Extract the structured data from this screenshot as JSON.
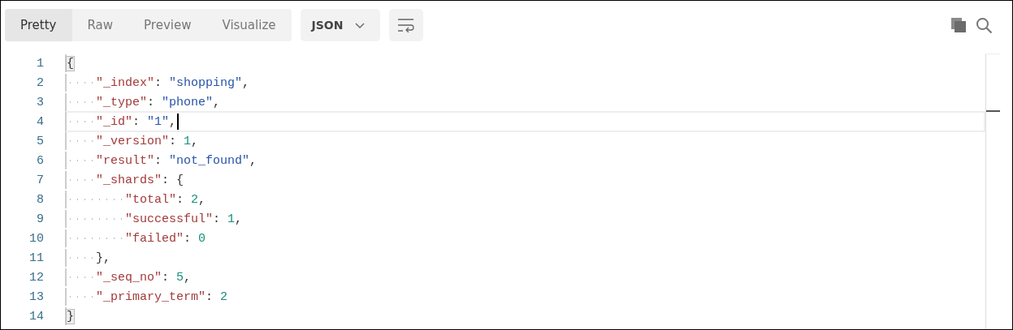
{
  "tabs": [
    {
      "label": "Pretty",
      "selected": true
    },
    {
      "label": "Raw",
      "selected": false
    },
    {
      "label": "Preview",
      "selected": false
    },
    {
      "label": "Visualize",
      "selected": false
    }
  ],
  "format_dropdown": {
    "value": "JSON"
  },
  "editor": {
    "lines": [
      {
        "number": "1",
        "current": false,
        "tokens": [
          {
            "kind": "brace_match",
            "text": "{"
          }
        ],
        "children": [
          {
            "number": "2",
            "current": false,
            "tokens": [
              {
                "kind": "key",
                "text": "\"_index\""
              },
              {
                "kind": "punct",
                "text": ": "
              },
              {
                "kind": "string",
                "text": "\"shopping\""
              },
              {
                "kind": "punct",
                "text": ","
              }
            ]
          },
          {
            "number": "3",
            "current": false,
            "tokens": [
              {
                "kind": "key",
                "text": "\"_type\""
              },
              {
                "kind": "punct",
                "text": ": "
              },
              {
                "kind": "string",
                "text": "\"phone\""
              },
              {
                "kind": "punct",
                "text": ","
              }
            ]
          },
          {
            "number": "4",
            "current": true,
            "tokens": [
              {
                "kind": "key",
                "text": "\"_id\""
              },
              {
                "kind": "punct",
                "text": ": "
              },
              {
                "kind": "string",
                "text": "\"1\""
              },
              {
                "kind": "punct",
                "text": ","
              }
            ]
          },
          {
            "number": "5",
            "current": false,
            "tokens": [
              {
                "kind": "key",
                "text": "\"_version\""
              },
              {
                "kind": "punct",
                "text": ": "
              },
              {
                "kind": "number",
                "text": "1"
              },
              {
                "kind": "punct",
                "text": ","
              }
            ]
          },
          {
            "number": "6",
            "current": false,
            "tokens": [
              {
                "kind": "key",
                "text": "\"result\""
              },
              {
                "kind": "punct",
                "text": ": "
              },
              {
                "kind": "string",
                "text": "\"not_found\""
              },
              {
                "kind": "punct",
                "text": ","
              }
            ]
          },
          {
            "number": "7",
            "current": false,
            "tokens": [
              {
                "kind": "key",
                "text": "\"_shards\""
              },
              {
                "kind": "punct",
                "text": ": {"
              }
            ],
            "children": [
              {
                "number": "8",
                "current": false,
                "tokens": [
                  {
                    "kind": "key",
                    "text": "\"total\""
                  },
                  {
                    "kind": "punct",
                    "text": ": "
                  },
                  {
                    "kind": "number",
                    "text": "2"
                  },
                  {
                    "kind": "punct",
                    "text": ","
                  }
                ]
              },
              {
                "number": "9",
                "current": false,
                "tokens": [
                  {
                    "kind": "key",
                    "text": "\"successful\""
                  },
                  {
                    "kind": "punct",
                    "text": ": "
                  },
                  {
                    "kind": "number",
                    "text": "1"
                  },
                  {
                    "kind": "punct",
                    "text": ","
                  }
                ]
              },
              {
                "number": "10",
                "current": false,
                "tokens": [
                  {
                    "kind": "key",
                    "text": "\"failed\""
                  },
                  {
                    "kind": "punct",
                    "text": ": "
                  },
                  {
                    "kind": "number",
                    "text": "0"
                  }
                ]
              }
            ]
          },
          {
            "number": "11",
            "current": false,
            "tokens": [
              {
                "kind": "punct",
                "text": "},"
              }
            ]
          },
          {
            "number": "12",
            "current": false,
            "tokens": [
              {
                "kind": "key",
                "text": "\"_seq_no\""
              },
              {
                "kind": "punct",
                "text": ": "
              },
              {
                "kind": "number",
                "text": "5"
              },
              {
                "kind": "punct",
                "text": ","
              }
            ]
          },
          {
            "number": "13",
            "current": false,
            "tokens": [
              {
                "kind": "key",
                "text": "\"_primary_term\""
              },
              {
                "kind": "punct",
                "text": ": "
              },
              {
                "kind": "number",
                "text": "2"
              }
            ]
          }
        ]
      },
      {
        "number": "14",
        "current": false,
        "tokens": [
          {
            "kind": "brace_match",
            "text": "}"
          }
        ]
      }
    ]
  }
}
